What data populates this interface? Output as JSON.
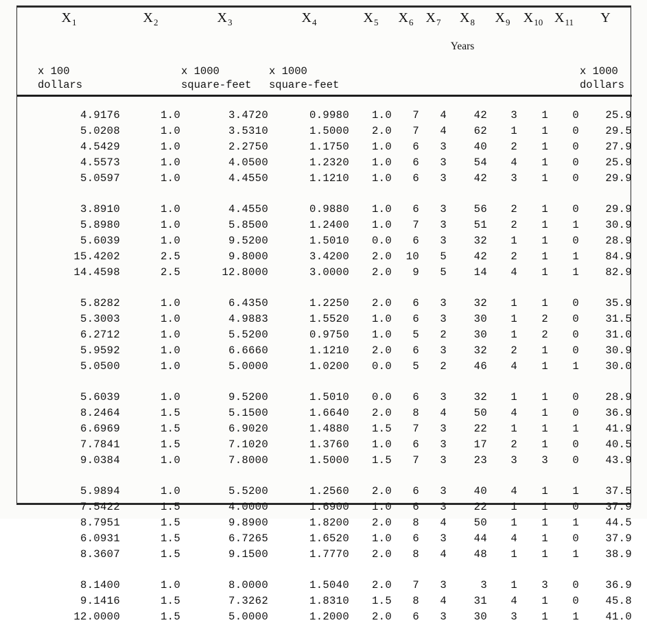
{
  "table": {
    "columns": [
      {
        "id": "x1",
        "symbol": "X",
        "subscript": "1",
        "units": "x 100\ndollars"
      },
      {
        "id": "x2",
        "symbol": "X",
        "subscript": "2",
        "units": ""
      },
      {
        "id": "x3",
        "symbol": "X",
        "subscript": "3",
        "units": "x 1000\nsquare-feet"
      },
      {
        "id": "x4",
        "symbol": "X",
        "subscript": "4",
        "units": "x 1000\nsquare-feet"
      },
      {
        "id": "x5",
        "symbol": "X",
        "subscript": "5",
        "units": ""
      },
      {
        "id": "x6",
        "symbol": "X",
        "subscript": "6",
        "units": ""
      },
      {
        "id": "x7",
        "symbol": "X",
        "subscript": "7",
        "units": ""
      },
      {
        "id": "x8",
        "symbol": "X",
        "subscript": "8",
        "units": "",
        "note": "Years"
      },
      {
        "id": "x9",
        "symbol": "X",
        "subscript": "9",
        "units": ""
      },
      {
        "id": "x10",
        "symbol": "X",
        "subscript": "10",
        "units": ""
      },
      {
        "id": "x11",
        "symbol": "X",
        "subscript": "11",
        "units": ""
      },
      {
        "id": "y",
        "symbol": "Y",
        "subscript": "",
        "units": "x 1000\ndollars"
      }
    ],
    "header_note": "Years",
    "groups": [
      {
        "rows": [
          [
            "4.9176",
            "1.0",
            "3.4720",
            "0.9980",
            "1.0",
            "7",
            "4",
            "42",
            "3",
            "1",
            "0",
            "25.9"
          ],
          [
            "5.0208",
            "1.0",
            "3.5310",
            "1.5000",
            "2.0",
            "7",
            "4",
            "62",
            "1",
            "1",
            "0",
            "29.5"
          ],
          [
            "4.5429",
            "1.0",
            "2.2750",
            "1.1750",
            "1.0",
            "6",
            "3",
            "40",
            "2",
            "1",
            "0",
            "27.9"
          ],
          [
            "4.5573",
            "1.0",
            "4.0500",
            "1.2320",
            "1.0",
            "6",
            "3",
            "54",
            "4",
            "1",
            "0",
            "25.9"
          ],
          [
            "5.0597",
            "1.0",
            "4.4550",
            "1.1210",
            "1.0",
            "6",
            "3",
            "42",
            "3",
            "1",
            "0",
            "29.9"
          ]
        ]
      },
      {
        "rows": [
          [
            "3.8910",
            "1.0",
            "4.4550",
            "0.9880",
            "1.0",
            "6",
            "3",
            "56",
            "2",
            "1",
            "0",
            "29.9"
          ],
          [
            "5.8980",
            "1.0",
            "5.8500",
            "1.2400",
            "1.0",
            "7",
            "3",
            "51",
            "2",
            "1",
            "1",
            "30.9"
          ],
          [
            "5.6039",
            "1.0",
            "9.5200",
            "1.5010",
            "0.0",
            "6",
            "3",
            "32",
            "1",
            "1",
            "0",
            "28.9"
          ],
          [
            "15.4202",
            "2.5",
            "9.8000",
            "3.4200",
            "2.0",
            "10",
            "5",
            "42",
            "2",
            "1",
            "1",
            "84.9"
          ],
          [
            "14.4598",
            "2.5",
            "12.8000",
            "3.0000",
            "2.0",
            "9",
            "5",
            "14",
            "4",
            "1",
            "1",
            "82.9"
          ]
        ]
      },
      {
        "rows": [
          [
            "5.8282",
            "1.0",
            "6.4350",
            "1.2250",
            "2.0",
            "6",
            "3",
            "32",
            "1",
            "1",
            "0",
            "35.9"
          ],
          [
            "5.3003",
            "1.0",
            "4.9883",
            "1.5520",
            "1.0",
            "6",
            "3",
            "30",
            "1",
            "2",
            "0",
            "31.5"
          ],
          [
            "6.2712",
            "1.0",
            "5.5200",
            "0.9750",
            "1.0",
            "5",
            "2",
            "30",
            "1",
            "2",
            "0",
            "31.0"
          ],
          [
            "5.9592",
            "1.0",
            "6.6660",
            "1.1210",
            "2.0",
            "6",
            "3",
            "32",
            "2",
            "1",
            "0",
            "30.9"
          ],
          [
            "5.0500",
            "1.0",
            "5.0000",
            "1.0200",
            "0.0",
            "5",
            "2",
            "46",
            "4",
            "1",
            "1",
            "30.0"
          ]
        ]
      },
      {
        "rows": [
          [
            "5.6039",
            "1.0",
            "9.5200",
            "1.5010",
            "0.0",
            "6",
            "3",
            "32",
            "1",
            "1",
            "0",
            "28.9"
          ],
          [
            "8.2464",
            "1.5",
            "5.1500",
            "1.6640",
            "2.0",
            "8",
            "4",
            "50",
            "4",
            "1",
            "0",
            "36.9"
          ],
          [
            "6.6969",
            "1.5",
            "6.9020",
            "1.4880",
            "1.5",
            "7",
            "3",
            "22",
            "1",
            "1",
            "1",
            "41.9"
          ],
          [
            "7.7841",
            "1.5",
            "7.1020",
            "1.3760",
            "1.0",
            "6",
            "3",
            "17",
            "2",
            "1",
            "0",
            "40.5"
          ],
          [
            "9.0384",
            "1.0",
            "7.8000",
            "1.5000",
            "1.5",
            "7",
            "3",
            "23",
            "3",
            "3",
            "0",
            "43.9"
          ]
        ]
      },
      {
        "rows": [
          [
            "5.9894",
            "1.0",
            "5.5200",
            "1.2560",
            "2.0",
            "6",
            "3",
            "40",
            "4",
            "1",
            "1",
            "37.5"
          ],
          [
            "7.5422",
            "1.5",
            "4.0000",
            "1.6900",
            "1.0",
            "6",
            "3",
            "22",
            "1",
            "1",
            "0",
            "37.9"
          ],
          [
            "8.7951",
            "1.5",
            "9.8900",
            "1.8200",
            "2.0",
            "8",
            "4",
            "50",
            "1",
            "1",
            "1",
            "44.5"
          ],
          [
            "6.0931",
            "1.5",
            "6.7265",
            "1.6520",
            "1.0",
            "6",
            "3",
            "44",
            "4",
            "1",
            "0",
            "37.9"
          ],
          [
            "8.3607",
            "1.5",
            "9.1500",
            "1.7770",
            "2.0",
            "8",
            "4",
            "48",
            "1",
            "1",
            "1",
            "38.9"
          ]
        ]
      },
      {
        "rows": [
          [
            "8.1400",
            "1.0",
            "8.0000",
            "1.5040",
            "2.0",
            "7",
            "3",
            "3",
            "1",
            "3",
            "0",
            "36.9"
          ],
          [
            "9.1416",
            "1.5",
            "7.3262",
            "1.8310",
            "1.5",
            "8",
            "4",
            "31",
            "4",
            "1",
            "0",
            "45.8"
          ],
          [
            "12.0000",
            "1.5",
            "5.0000",
            "1.2000",
            "2.0",
            "6",
            "3",
            "30",
            "3",
            "1",
            "1",
            "41.0"
          ]
        ]
      }
    ]
  }
}
